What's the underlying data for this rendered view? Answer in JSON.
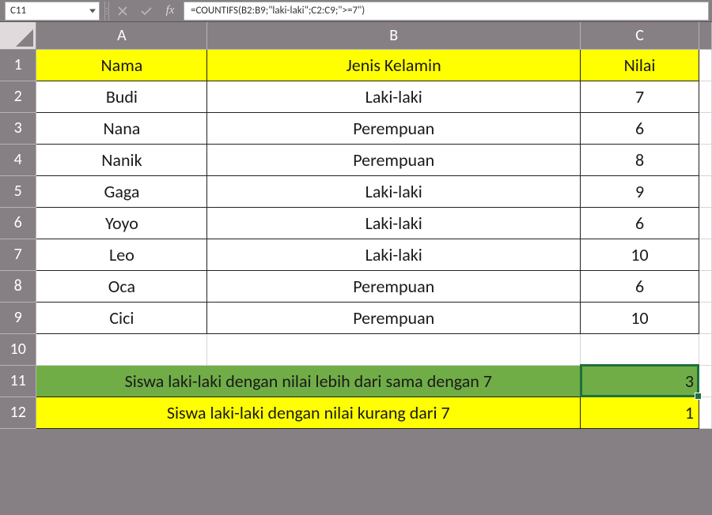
{
  "nameBox": "C11",
  "formula": "=COUNTIFS(B2:B9;\"laki-laki\";C2:C9;\">=7\")",
  "fxLabel": "fx",
  "columns": [
    "A",
    "B",
    "C"
  ],
  "rowNumbers": [
    "1",
    "2",
    "3",
    "4",
    "5",
    "6",
    "7",
    "8",
    "9",
    "10",
    "11",
    "12"
  ],
  "header": {
    "A": "Nama",
    "B": "Jenis Kelamin",
    "C": "Nilai"
  },
  "rows": [
    {
      "A": "Budi",
      "B": "Laki-laki",
      "C": "7"
    },
    {
      "A": "Nana",
      "B": "Perempuan",
      "C": "6"
    },
    {
      "A": "Nanik",
      "B": "Perempuan",
      "C": "8"
    },
    {
      "A": "Gaga",
      "B": "Laki-laki",
      "C": "9"
    },
    {
      "A": "Yoyo",
      "B": "Laki-laki",
      "C": "6"
    },
    {
      "A": "Leo",
      "B": "Laki-laki",
      "C": "10"
    },
    {
      "A": "Oca",
      "B": "Perempuan",
      "C": "6"
    },
    {
      "A": "Cici",
      "B": "Perempuan",
      "C": "10"
    }
  ],
  "summary": {
    "row11": {
      "label": "Siswa laki-laki dengan nilai lebih dari sama dengan 7",
      "value": "3"
    },
    "row12": {
      "label": "Siswa laki-laki dengan nilai kurang dari 7",
      "value": "1"
    }
  },
  "colors": {
    "headerBg": "#ffff00",
    "greenRow": "#70ad47",
    "yellowRow": "#ffff00",
    "selectionOutline": "#1f6f3f"
  },
  "chart_data": {
    "type": "table",
    "title": "",
    "columns": [
      "Nama",
      "Jenis Kelamin",
      "Nilai"
    ],
    "rows": [
      [
        "Budi",
        "Laki-laki",
        7
      ],
      [
        "Nana",
        "Perempuan",
        6
      ],
      [
        "Nanik",
        "Perempuan",
        8
      ],
      [
        "Gaga",
        "Laki-laki",
        9
      ],
      [
        "Yoyo",
        "Laki-laki",
        6
      ],
      [
        "Leo",
        "Laki-laki",
        10
      ],
      [
        "Oca",
        "Perempuan",
        6
      ],
      [
        "Cici",
        "Perempuan",
        10
      ]
    ],
    "aggregates": [
      {
        "label": "Siswa laki-laki dengan nilai lebih dari sama dengan 7",
        "value": 3
      },
      {
        "label": "Siswa laki-laki dengan nilai kurang dari 7",
        "value": 1
      }
    ]
  }
}
